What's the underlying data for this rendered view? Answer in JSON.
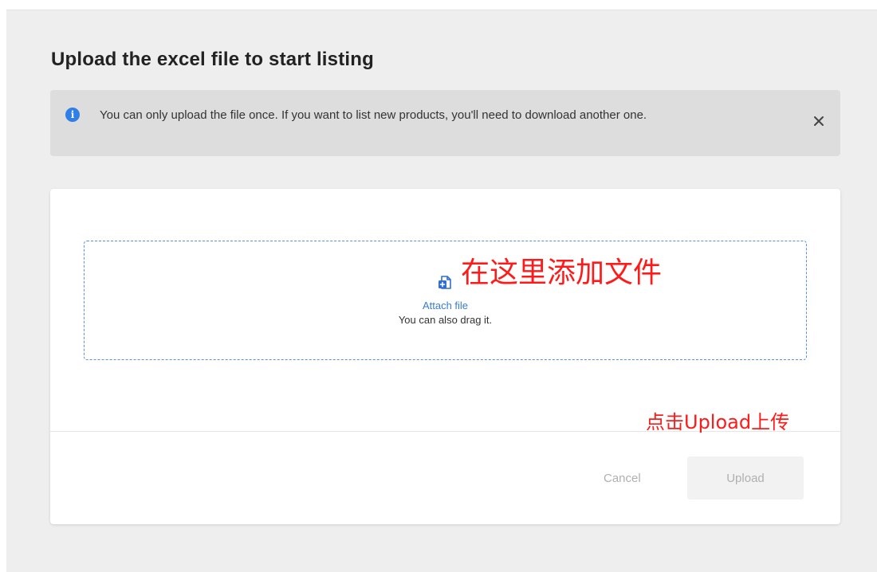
{
  "page": {
    "title": "Upload the excel file to start listing"
  },
  "notice": {
    "icon": "info-icon",
    "icon_glyph": "i",
    "text": "You can only upload the file once. If you want to list new products, you'll need to download another one.",
    "close_icon": "close-icon"
  },
  "dropzone": {
    "icon": "attach-file-icon",
    "link_label": "Attach file",
    "hint": "You can also drag it."
  },
  "annotations": {
    "attach_note": "在这里添加文件",
    "upload_note": "点击Upload上传"
  },
  "actions": {
    "cancel_label": "Cancel",
    "upload_label": "Upload"
  },
  "colors": {
    "accent": "#2f7fe6",
    "link": "#3a7bd5",
    "annotation": "#ff1a1a",
    "disabled_text": "#b0b0b0"
  }
}
